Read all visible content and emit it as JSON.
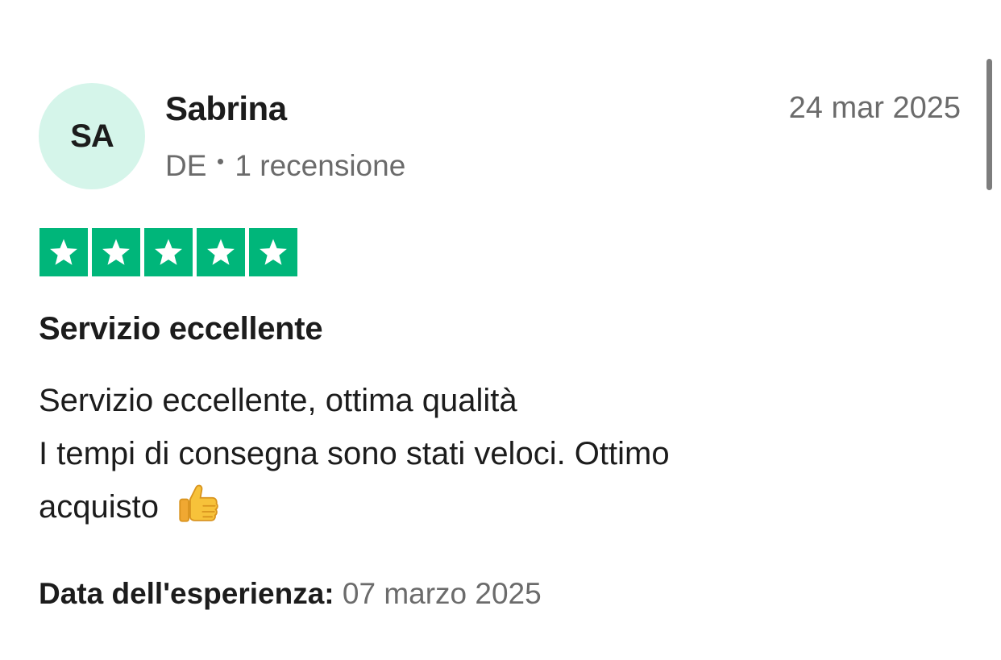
{
  "review": {
    "avatar_initials": "SA",
    "reviewer_name": "Sabrina",
    "country": "DE",
    "review_count": "1 recensione",
    "date": "24 mar 2025",
    "rating": 5,
    "rating_max": 5,
    "title": "Servizio eccellente",
    "body_lines": [
      "Servizio eccellente, ottima qualità",
      "I tempi di consegna sono stati veloci. Ottimo",
      "acquisto"
    ],
    "body_emoji": "thumbs-up-icon",
    "experience_label": "Data dell'esperienza:",
    "experience_date": "07 marzo 2025"
  },
  "colors": {
    "star_green": "#00b67a",
    "avatar_bg": "#d5f5ea",
    "muted_text": "#6b6b6b",
    "primary_text": "#1c1c1c"
  }
}
